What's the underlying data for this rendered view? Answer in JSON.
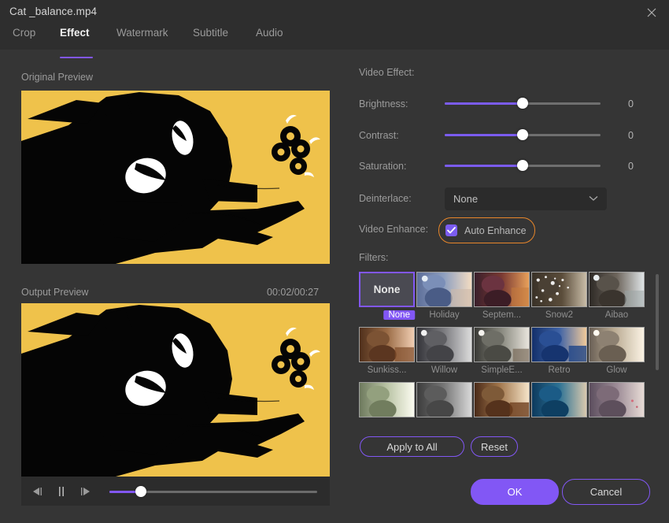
{
  "window": {
    "title": "Cat _balance.mp4",
    "close_icon": "close-icon"
  },
  "tabs": [
    {
      "label": "Crop",
      "active": false
    },
    {
      "label": "Effect",
      "active": true
    },
    {
      "label": "Watermark",
      "active": false
    },
    {
      "label": "Subtitle",
      "active": false
    },
    {
      "label": "Audio",
      "active": false
    }
  ],
  "left": {
    "original_label": "Original Preview",
    "output_label": "Output Preview",
    "time": "00:02/00:27",
    "controls": {
      "prev_frame": "previous-frame-icon",
      "pause": "pause-icon",
      "next_frame": "next-frame-icon",
      "progress_percent": 15
    }
  },
  "right": {
    "section_title": "Video Effect:",
    "sliders": [
      {
        "label": "Brightness:",
        "value": "0",
        "percent": 50
      },
      {
        "label": "Contrast:",
        "value": "0",
        "percent": 50
      },
      {
        "label": "Saturation:",
        "value": "0",
        "percent": 50
      }
    ],
    "deinterlace": {
      "label": "Deinterlace:",
      "value": "None"
    },
    "video_enhance": {
      "label": "Video Enhance:",
      "checkbox_label": "Auto Enhance",
      "checked": true
    },
    "filters_label": "Filters:",
    "filters": [
      {
        "name": "None",
        "selected": true
      },
      {
        "name": "Holiday",
        "selected": false
      },
      {
        "name": "Septem...",
        "selected": false
      },
      {
        "name": "Snow2",
        "selected": false
      },
      {
        "name": "Aibao",
        "selected": false
      },
      {
        "name": "Sunkiss...",
        "selected": false
      },
      {
        "name": "Willow",
        "selected": false
      },
      {
        "name": "SimpleE...",
        "selected": false
      },
      {
        "name": "Retro",
        "selected": false
      },
      {
        "name": "Glow",
        "selected": false
      }
    ],
    "apply_all_label": "Apply to All",
    "reset_label": "Reset",
    "ok_label": "OK",
    "cancel_label": "Cancel"
  },
  "colors": {
    "accent": "#8257f5",
    "highlight_ring": "#e8862a",
    "preview_bg": "#efc24b",
    "window_bg": "#353535",
    "titlebar_bg": "#2e2e2e"
  }
}
